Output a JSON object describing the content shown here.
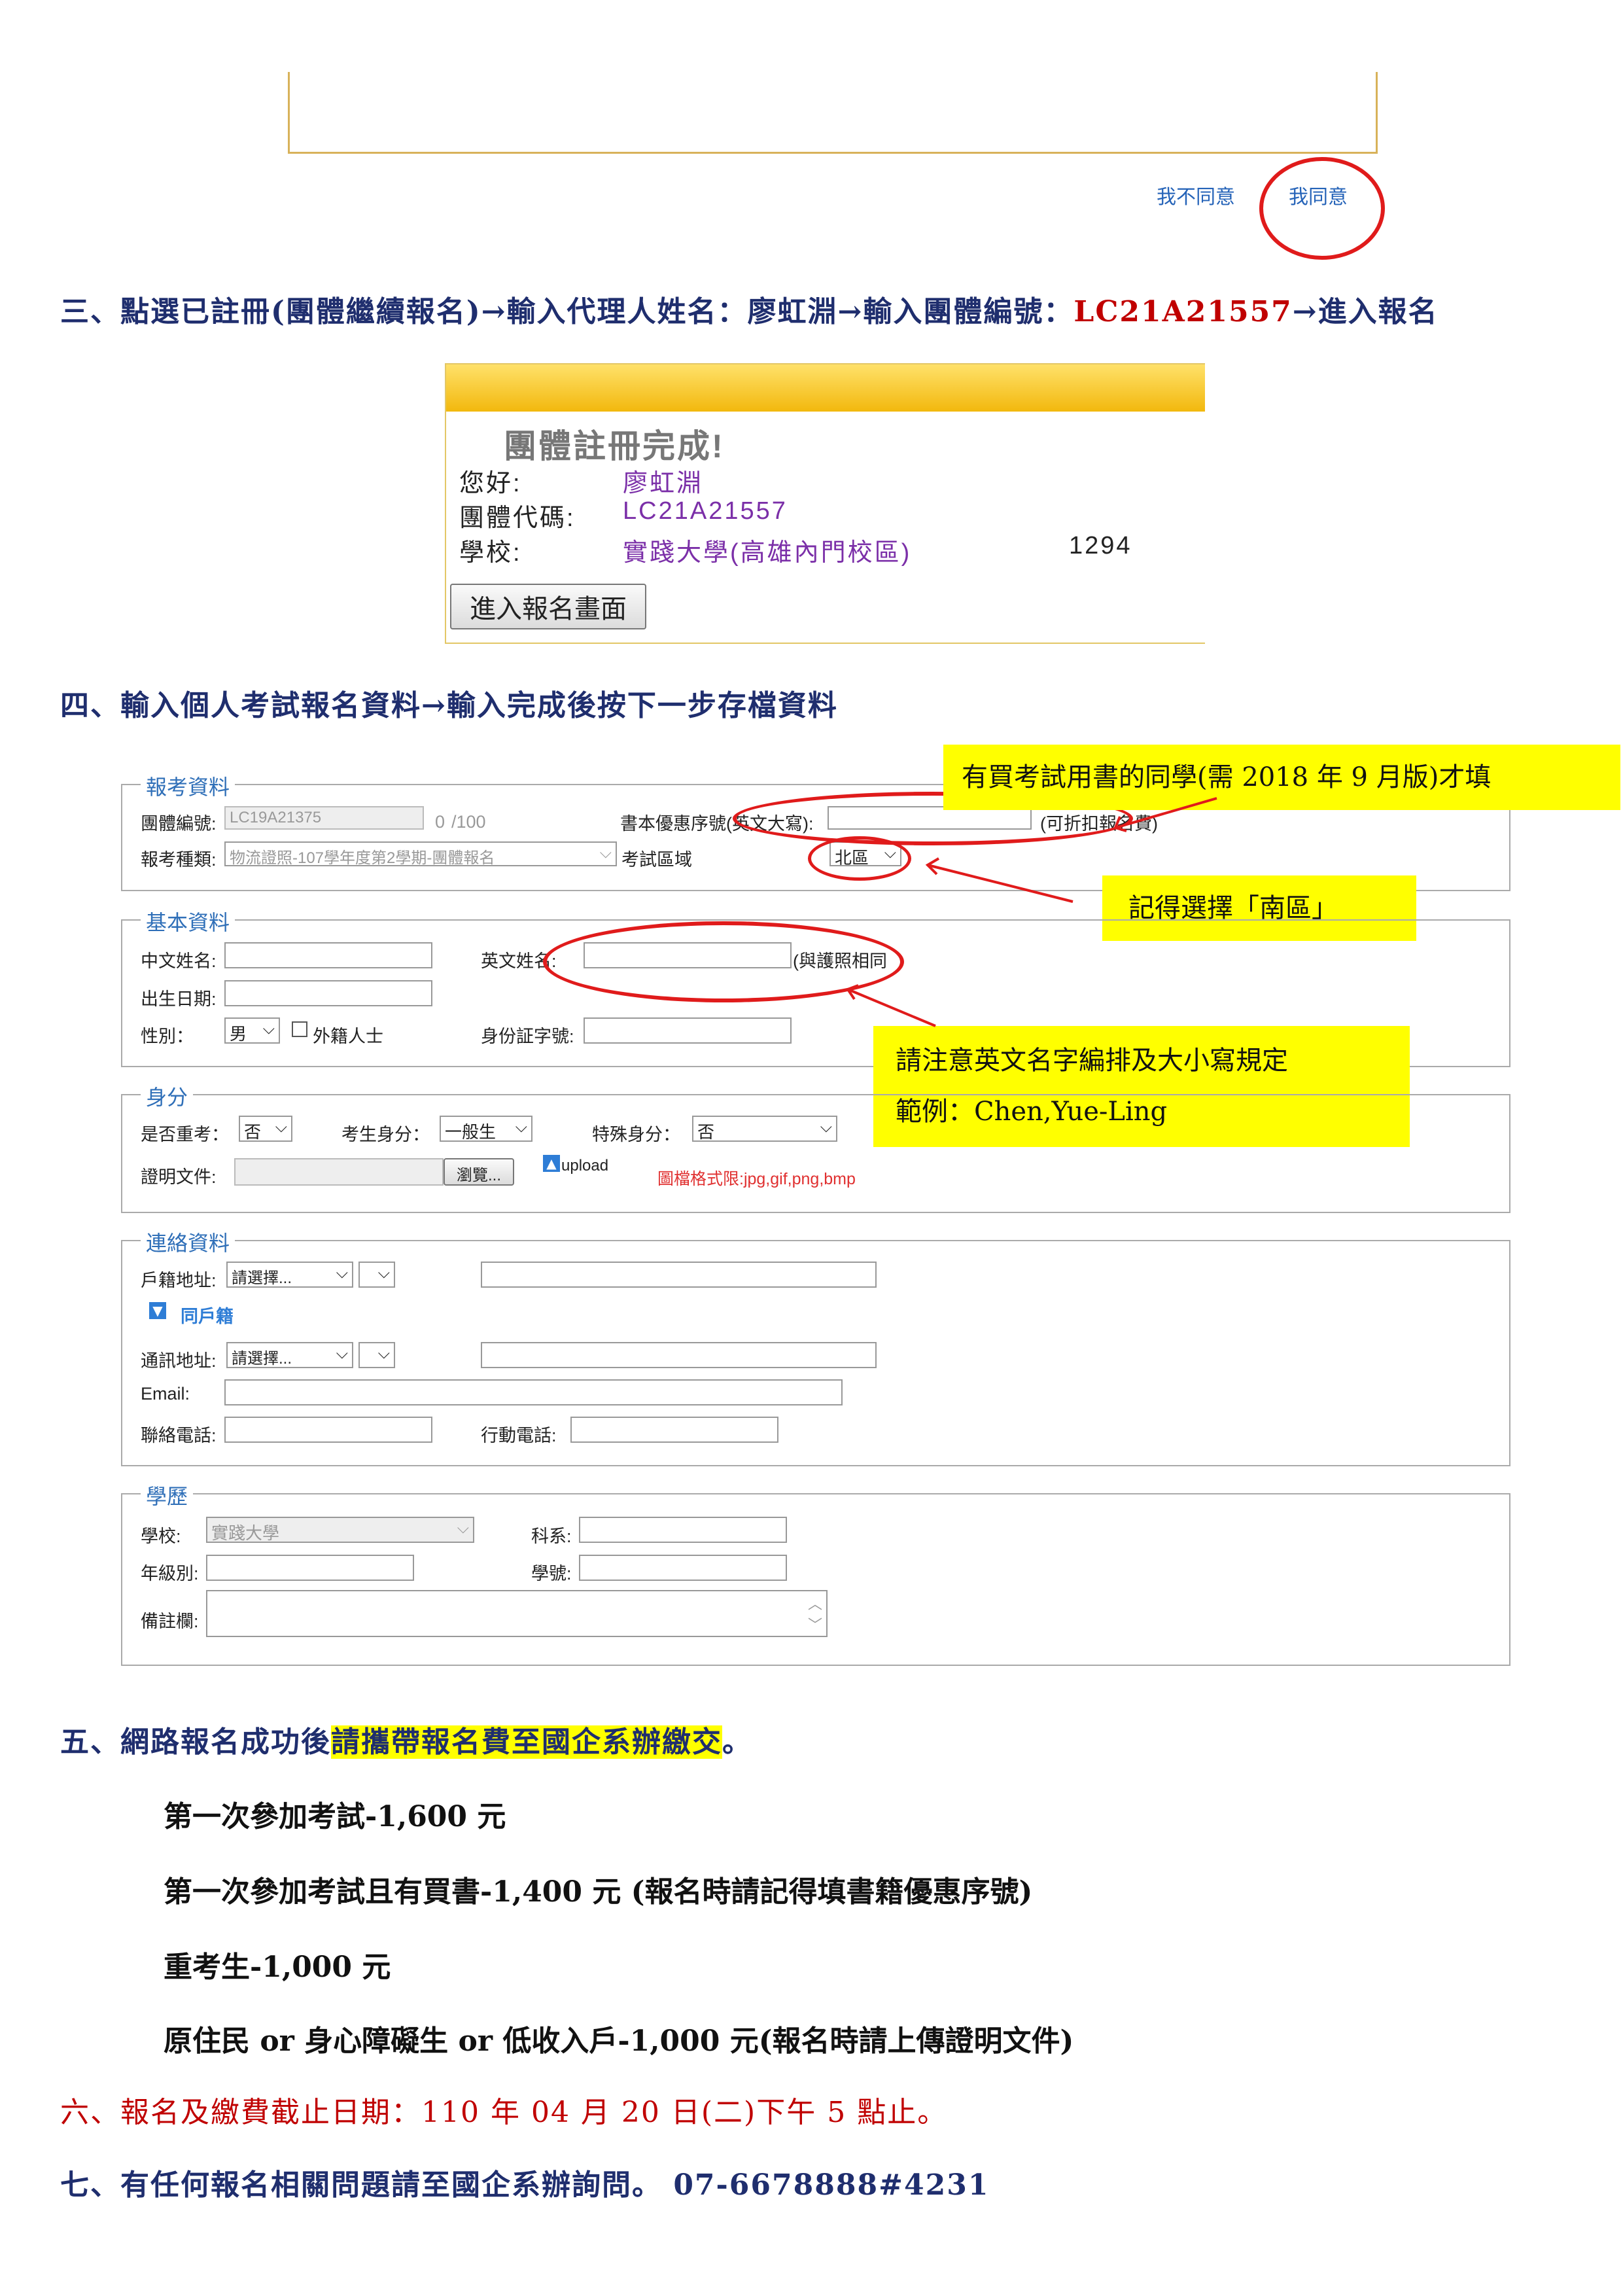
{
  "top": {
    "disagree": "我不同意",
    "agree": "我同意"
  },
  "step3": {
    "prefix": "三、點選已註冊(團體繼續報名)",
    "arrow": "→",
    "part2": "輸入代理人姓名：廖虹淵",
    "part3": "輸入團體編號：",
    "code": "LC21A21557",
    "part4": "進入報名"
  },
  "panel": {
    "title": "團體註冊完成!",
    "greet_label": "您好:",
    "greet_value": "廖虹淵",
    "code_label": "團體代碼:",
    "code_value": "LC21A21557",
    "school_label": "學校:",
    "school_value": "實踐大學(高雄內門校區)",
    "school_num": "1294",
    "enter_button": "進入報名畫面"
  },
  "step4": {
    "text": "四、輸入個人考試報名資料",
    "arrow": "→",
    "text2": "輸入完成後按下一步存檔資料"
  },
  "callouts": {
    "book": "有買考試用書的同學(需 2018 年 9 月版)才填",
    "region": "記得選擇「南區」",
    "english_line1": "請注意英文名字編排及大小寫規定",
    "english_line2": "範例：Chen,Yue-Ling"
  },
  "form": {
    "exam": {
      "legend": "報考資料",
      "group_no_label": "團體編號:",
      "group_no_value": "LC19A21375",
      "count": "0",
      "count_total": "/100",
      "book_serial_label": "書本優惠序號(英文大寫):",
      "book_serial_note": "(可折扣報名費)",
      "type_label": "報考種類:",
      "type_value": "物流證照-107學年度第2學期-團體報名",
      "region_label": "考試區域",
      "region_value": "北區"
    },
    "basic": {
      "legend": "基本資料",
      "cname_label": "中文姓名:",
      "ename_label": "英文姓名:",
      "ename_note": "(與護照相同",
      "birth_label": "出生日期:",
      "gender_label": "性別：",
      "gender_value": "男",
      "foreign_label": "外籍人士",
      "id_label": "身份証字號:"
    },
    "identity": {
      "legend": "身分",
      "retake_label": "是否重考：",
      "retake_value": "否",
      "status_label": "考生身分：",
      "status_value": "一般生",
      "special_label": "特殊身分：",
      "special_value": "否",
      "doc_label": "證明文件:",
      "browse": "瀏覽...",
      "upload": "upload",
      "format_note": "圖檔格式限:jpg,gif,png,bmp"
    },
    "contact": {
      "legend": "連絡資料",
      "household_label": "戶籍地址:",
      "choose": "請選擇...",
      "same_label": "同戶籍",
      "mail_label": "通訊地址:",
      "email_label": "Email:",
      "phone_label": "聯絡電話:",
      "mobile_label": "行動電話:"
    },
    "edu": {
      "legend": "學歷",
      "school_label": "學校:",
      "school_value": "實踐大學",
      "dept_label": "科系:",
      "grade_label": "年級別:",
      "student_no_label": "學號:",
      "note_label": "備註欄:"
    }
  },
  "step5": {
    "prefix": "五、網路報名成功後",
    "highlight": "請攜帶報名費至國企系辦繳交",
    "suffix": "。",
    "fees": [
      "第一次參加考試-1,600 元",
      "第一次參加考試且有買書-1,400 元 (報名時請記得填書籍優惠序號)",
      "重考生-1,000 元",
      "原住民 or 身心障礙生 or 低收入戶-1,000 元(報名時請上傳證明文件)"
    ]
  },
  "step6": "六、報名及繳費截止日期：110 年 04 月 20 日(二)下午 5 點止。",
  "step7": "七、有任何報名相關問題請至國企系辦詢問。 07-6678888#4231"
}
